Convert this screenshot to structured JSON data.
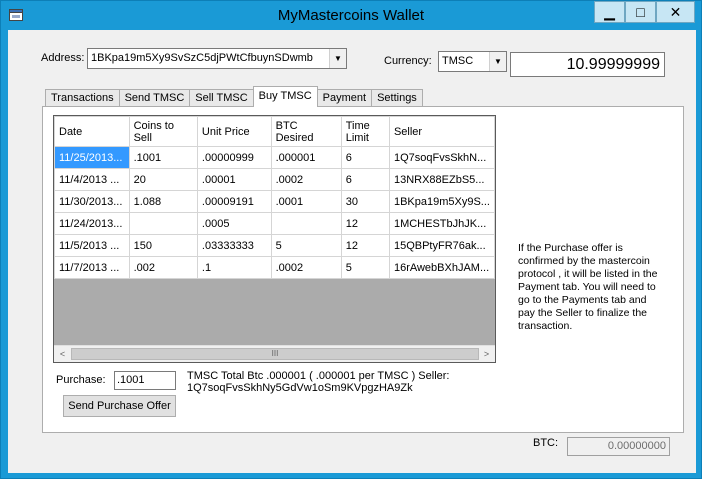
{
  "window": {
    "title": "MyMastercoins Wallet",
    "minimize_glyph": "▁",
    "maximize_glyph": "□",
    "close_glyph": "✕"
  },
  "address": {
    "label": "Address:",
    "value": "1BKpa19m5Xy9SvSzC5djPWtCfbuynSDwmb"
  },
  "currency": {
    "label": "Currency:",
    "value": "TMSC"
  },
  "balance": "10.99999999",
  "tabs": [
    {
      "label": "Transactions"
    },
    {
      "label": "Send TMSC"
    },
    {
      "label": "Sell TMSC"
    },
    {
      "label": "Buy TMSC",
      "active": true
    },
    {
      "label": "Payment"
    },
    {
      "label": "Settings"
    }
  ],
  "offers_table": {
    "columns": [
      "Date",
      "Coins to Sell",
      "Unit Price",
      "BTC Desired",
      "Time Limit",
      "Seller"
    ],
    "rows": [
      [
        "11/25/2013...",
        ".1001",
        ".00000999",
        ".000001",
        "6",
        "1Q7soqFvsSkhN..."
      ],
      [
        "11/4/2013 ...",
        "20",
        ".00001",
        ".0002",
        "6",
        "13NRX88EZbS5..."
      ],
      [
        "11/30/2013...",
        "1.088",
        ".00009191",
        ".0001",
        "30",
        "1BKpa19m5Xy9S..."
      ],
      [
        "11/24/2013...",
        "",
        ".0005",
        "",
        "12",
        "1MCHESTbJhJK..."
      ],
      [
        "11/5/2013 ...",
        "150",
        ".03333333",
        "5",
        "12",
        "15QBPtyFR76ak..."
      ],
      [
        "11/7/2013 ...",
        ".002",
        ".1",
        ".0002",
        "5",
        "16rAwebBXhJAM..."
      ]
    ],
    "selected_row": 0
  },
  "scroll": {
    "left_glyph": "<",
    "right_glyph": ">",
    "thumb_glyph": "III"
  },
  "info_text": "If the Purchase offer is confirmed by the mastercoin protocol , it will be listed in the Payment tab.   You will need to go to the Payments tab and pay the Seller to finalize the transaction.",
  "purchase": {
    "label": "Purchase:",
    "value": ".1001",
    "summary_line1": "TMSC  Total Btc .000001 ( .000001 per TMSC )    Seller:",
    "summary_line2": "1Q7soqFvsSkhNy5GdVw1oSm9KVpgzHA9Zk",
    "button_label": "Send Purchase Offer"
  },
  "btc": {
    "label": "BTC:",
    "value": "0.00000000"
  },
  "colors": {
    "titlebar": "#1a9ad6",
    "selection": "#3399ff"
  }
}
